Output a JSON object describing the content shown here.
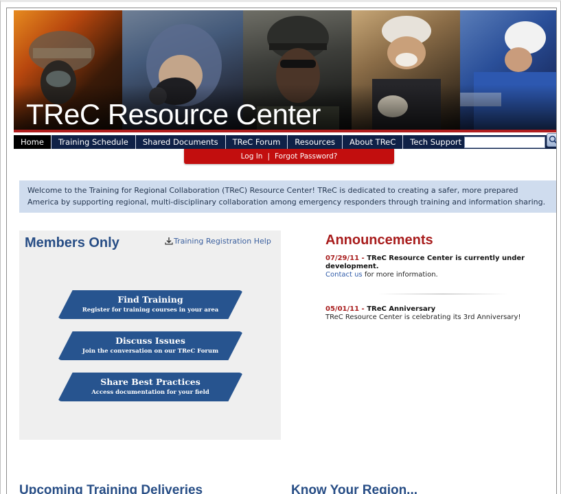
{
  "banner": {
    "title": "TReC Resource Center",
    "photos": [
      "firefighter-photo",
      "hazmat-responder-photo",
      "tactical-officer-photo",
      "rescue-worker-photo",
      "technician-photo"
    ]
  },
  "nav": {
    "items": [
      {
        "label": "Home",
        "active": true
      },
      {
        "label": "Training Schedule"
      },
      {
        "label": "Shared Documents"
      },
      {
        "label": "TReC Forum"
      },
      {
        "label": "Resources"
      },
      {
        "label": "About TReC"
      },
      {
        "label": "Tech Support"
      }
    ],
    "search_value": "",
    "search_icon": "magnifier-icon"
  },
  "login": {
    "login_label": "Log In",
    "separator": "|",
    "forgot_label": "Forgot Password?"
  },
  "welcome": {
    "text": "Welcome to the Training for Regional Collaboration (TReC) Resource Center! TReC is dedicated to creating a safer, more prepared America by supporting regional, multi-disciplinary collaboration among emergency responders through training and information sharing."
  },
  "members": {
    "title": "Members Only",
    "registration_help": "Training Registration Help",
    "buttons": [
      {
        "title": "Find Training",
        "subtitle": "Register for training courses in your area"
      },
      {
        "title": "Discuss Issues",
        "subtitle": "Join the conversation on our TReC Forum"
      },
      {
        "title": "Share Best Practices",
        "subtitle": "Access documentation for your field"
      }
    ]
  },
  "announcements": {
    "title": "Announcements",
    "items": [
      {
        "date": "07/29/11",
        "dash": " - ",
        "headline": "TReC Resource Center is currently under development.",
        "link": "Contact us",
        "body": " for more information."
      },
      {
        "date": "05/01/11",
        "dash": " - ",
        "headline": "TReC Anniversary",
        "body": "TReC Resource Center is celebrating its 3rd Anniversary!"
      }
    ]
  },
  "sections": {
    "upcoming": "Upcoming Training Deliveries",
    "region": "Know Your Region..."
  },
  "colors": {
    "nav_bg": "#0f2147",
    "login_bar": "#c20e0e",
    "welcome_bg": "#cfdcee",
    "heading_blue": "#274d85",
    "announcement_red": "#a81c1c",
    "pill_blue": "#27548f"
  }
}
